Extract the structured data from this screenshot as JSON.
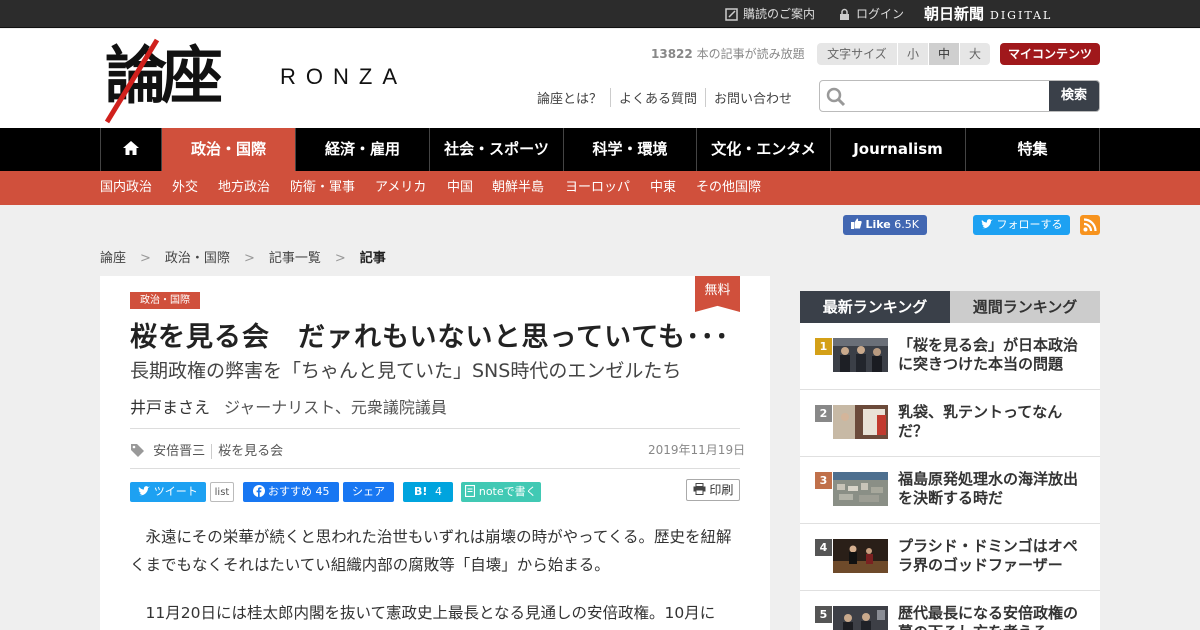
{
  "topbar": {
    "subscribe": "購読のご案内",
    "login": "ログイン",
    "asahi": "朝日新聞",
    "digital": "DIGITAL"
  },
  "logo": {
    "kanji": "論座",
    "roman": "RONZA"
  },
  "header": {
    "free_count": "13822",
    "free_text": "本の記事が読み放題",
    "font_size_label": "文字サイズ",
    "font_sizes": [
      "小",
      "中",
      "大"
    ],
    "font_size_selected": "中",
    "my_contents": "マイコンテンツ",
    "links": [
      "論座とは？",
      "よくある質問",
      "お問い合わせ"
    ],
    "search_placeholder": "",
    "search_button": "検索"
  },
  "nav": {
    "home_icon": "home-icon",
    "items": [
      "政治・国際",
      "経済・雇用",
      "社会・スポーツ",
      "科学・環境",
      "文化・エンタメ",
      "Journalism",
      "特集"
    ],
    "active": "政治・国際"
  },
  "subnav": [
    "国内政治",
    "外交",
    "地方政治",
    "防衛・軍事",
    "アメリカ",
    "中国",
    "朝鮮半島",
    "ヨーロッパ",
    "中東",
    "その他国際"
  ],
  "social": {
    "fb_like": "Like",
    "fb_count": "6.5K",
    "tw_follow": "フォローする"
  },
  "breadcrumb": [
    "論座",
    "政治・国際",
    "記事一覧",
    "記事"
  ],
  "article": {
    "badge": "無料",
    "category": "政治・国際",
    "title": "桜を見る会　だァれもいないと思っていても･･･",
    "subtitle": "長期政権の弊害を「ちゃんと見ていた」SNS時代のエンゼルたち",
    "author": "井戸まさえ",
    "author_role": "ジャーナリスト、元衆議院議員",
    "tags": [
      "安倍晋三",
      "桜を見る会"
    ],
    "date": "2019年11月19日",
    "share": {
      "tweet": "ツイート",
      "list": "list",
      "fb_recommend": "おすすめ",
      "fb_count": "45",
      "fb_share": "シェア",
      "hatena": "B!",
      "hatena_count": "4",
      "note": "noteで書く",
      "print": "印刷"
    },
    "paragraphs": [
      "永遠にその栄華が続くと思われた治世もいずれは崩壊の時がやってくる。歴史を紐解くまでもなくそれはたいてい組織内部の腐敗等「自壊」から始まる。",
      "11月20日には桂太郎内閣を抜いて憲政史上最長となる見通しの安倍政権。10月に"
    ]
  },
  "ranking": {
    "tabs": [
      "最新ランキング",
      "週間ランキング"
    ],
    "active_tab": "最新ランキング",
    "items": [
      {
        "num": "1",
        "title": "「桜を見る会」が日本政治に突きつけた本当の問題",
        "color": "#d4a017"
      },
      {
        "num": "2",
        "title": "乳袋、乳テントってなんだ？",
        "color": "#888888"
      },
      {
        "num": "3",
        "title": "福島原発処理水の海洋放出を決断する時だ",
        "color": "#c0704a"
      },
      {
        "num": "4",
        "title": "プラシド・ドミンゴはオペラ界のゴッドファーザー",
        "color": "#555555"
      },
      {
        "num": "5",
        "title": "歴代最長になる安倍政権の幕の下ろし方を考える",
        "color": "#555555"
      }
    ]
  },
  "colors": {
    "accent": "#d0503c",
    "dark": "#3a4049",
    "brand_red": "#a0181b"
  }
}
